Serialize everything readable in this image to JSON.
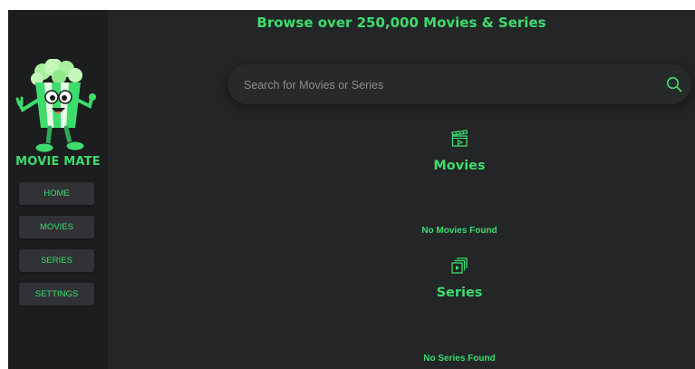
{
  "app": {
    "brand_name": "MOVIE MATE",
    "accent_color": "#3ddc6d",
    "background_color": "#232527",
    "sidebar_color": "#1c1d1f"
  },
  "sidebar": {
    "logo_icon": "popcorn-mascot-icon",
    "items": [
      {
        "label": "HOME"
      },
      {
        "label": "MOVIES"
      },
      {
        "label": "SERIES"
      },
      {
        "label": "SETTINGS"
      }
    ]
  },
  "header": {
    "headline": "Browse over 250,000 Movies & Series"
  },
  "search": {
    "placeholder": "Search for Movies or Series",
    "value": "",
    "icon": "search-icon"
  },
  "sections": {
    "movies": {
      "title": "Movies",
      "icon": "clapperboard-icon",
      "empty_message": "No Movies Found"
    },
    "series": {
      "title": "Series",
      "icon": "stacked-videos-icon",
      "empty_message": "No Series Found"
    }
  }
}
